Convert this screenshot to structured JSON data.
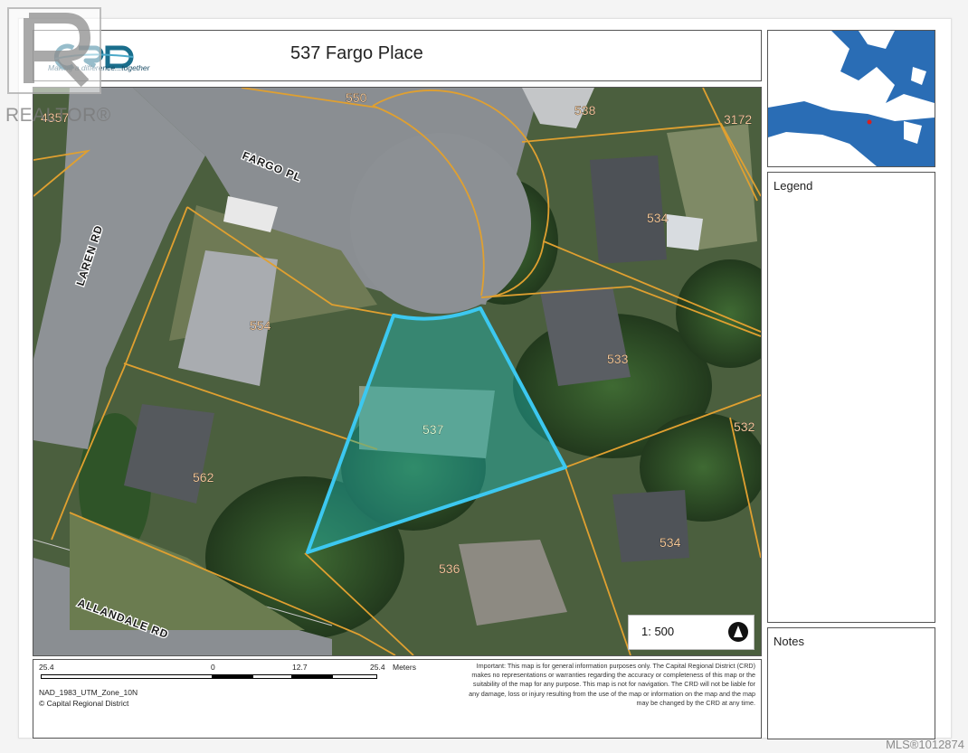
{
  "header": {
    "logo_text": "CRD",
    "tagline": "Making a difference...together",
    "title": "537 Fargo Place"
  },
  "panels": {
    "legend_label": "Legend",
    "notes_label": "Notes"
  },
  "map": {
    "scale_ratio": "1: 500",
    "lots": [
      {
        "id": "lot-550",
        "label": "550"
      },
      {
        "id": "lot-538",
        "label": "538"
      },
      {
        "id": "lot-3172",
        "label": "3172"
      },
      {
        "id": "lot-4357",
        "label": "4357"
      },
      {
        "id": "lot-534-north",
        "label": "534"
      },
      {
        "id": "lot-554",
        "label": "554"
      },
      {
        "id": "lot-533",
        "label": "533"
      },
      {
        "id": "lot-537",
        "label": "537"
      },
      {
        "id": "lot-532",
        "label": "532"
      },
      {
        "id": "lot-562",
        "label": "562"
      },
      {
        "id": "lot-534-south",
        "label": "534"
      },
      {
        "id": "lot-536",
        "label": "536"
      }
    ],
    "roads": [
      {
        "id": "fargo-pl",
        "label": "FARGO PL"
      },
      {
        "id": "laren-rd",
        "label": "LAREN RD"
      },
      {
        "id": "allandale-rd",
        "label": "ALLANDALE RD"
      }
    ],
    "colors": {
      "parcel_line": "#e0a030",
      "selected_outline": "#3cc8f0",
      "selected_fill": "#1fb5b0"
    }
  },
  "footer": {
    "scale_labels": [
      "25.4",
      "0",
      "12.7",
      "25.4"
    ],
    "scale_unit": "Meters",
    "projection": "NAD_1983_UTM_Zone_10N",
    "copyright": "© Capital Regional District",
    "disclaimer": "Important: This map is for general information purposes only. The Capital Regional District (CRD) makes no representations or warranties regarding the accuracy or completeness of this map or the suitability of the map for any purpose. This map is not for navigation. The CRD will not be liable for any damage, loss or injury resulting from the use of the map or information on the map and the map may be changed by the CRD at any time."
  },
  "watermark": {
    "realtor": "REALTOR®",
    "mls": "MLS®1012874"
  }
}
